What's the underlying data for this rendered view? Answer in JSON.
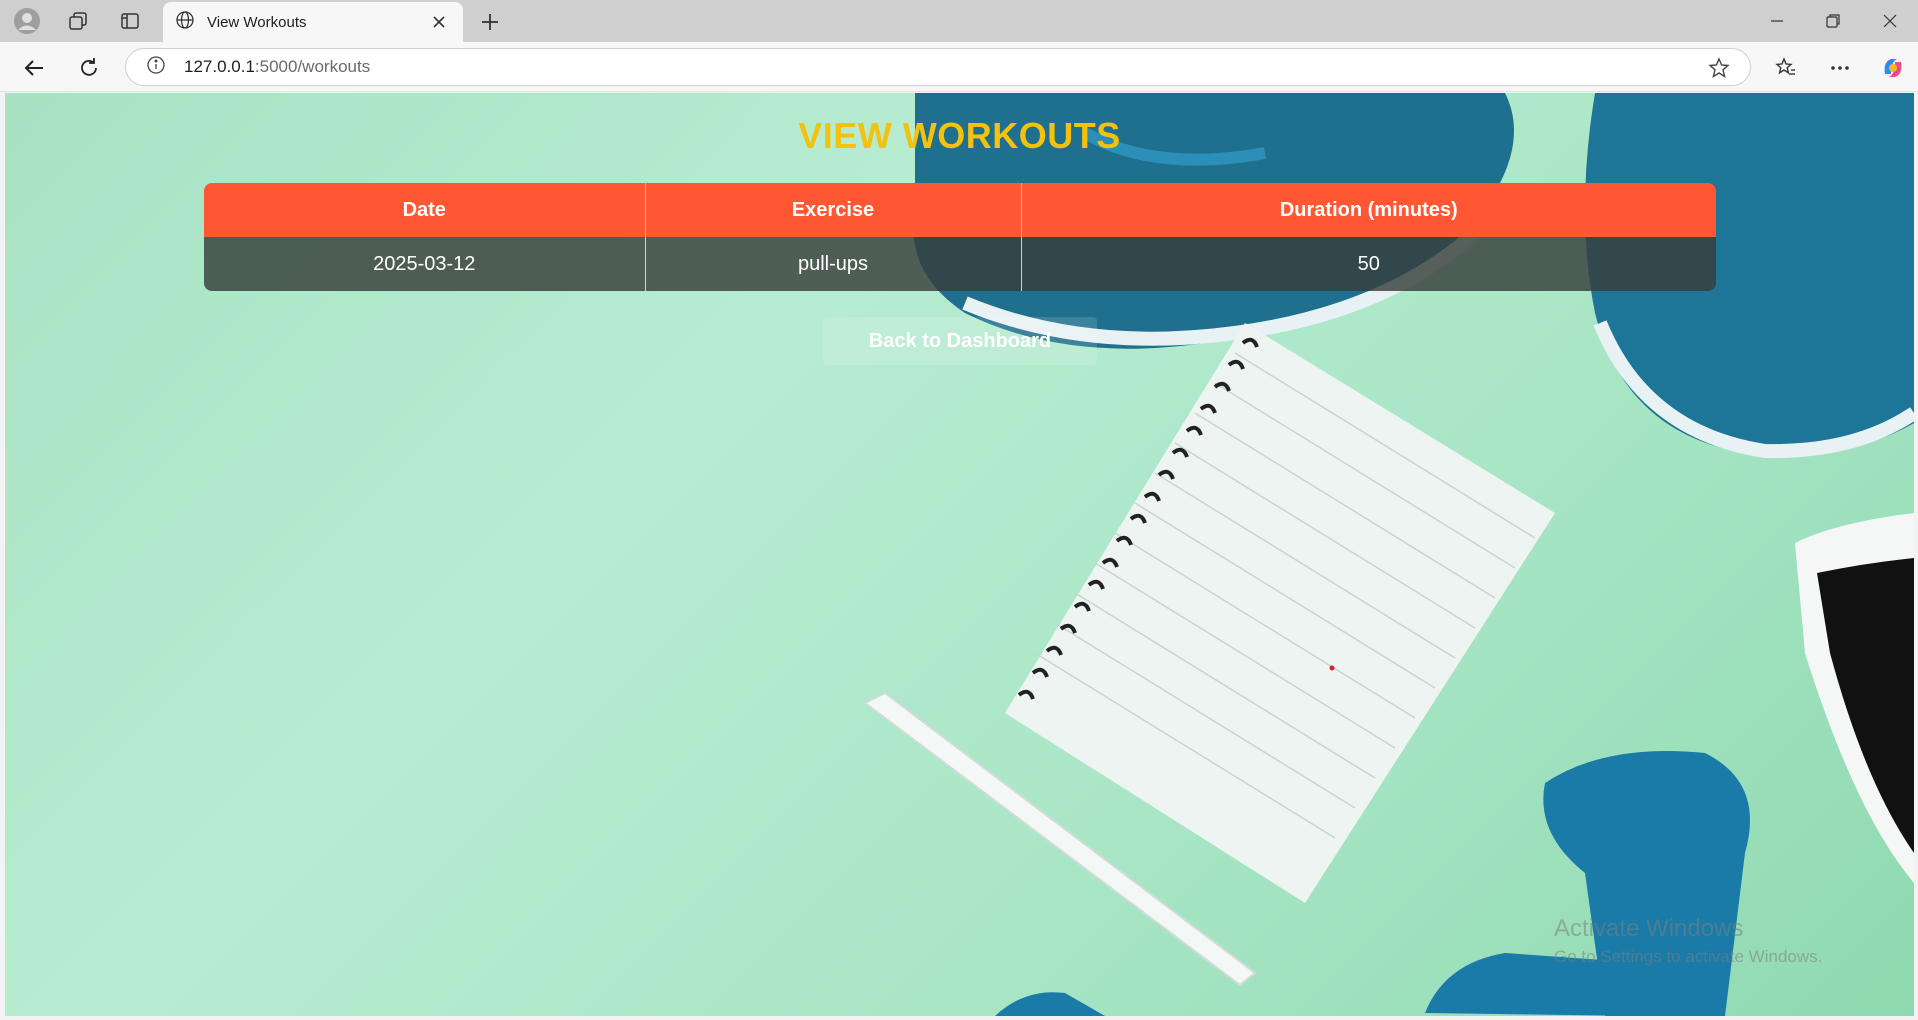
{
  "browser": {
    "tab_title": "View Workouts",
    "url_host": "127.0.0.1",
    "url_path": ":5000/workouts"
  },
  "page": {
    "title": "VIEW WORKOUTS",
    "table": {
      "headers": [
        "Date",
        "Exercise",
        "Duration (minutes)"
      ],
      "rows": [
        [
          "2025-03-12",
          "pull-ups",
          "50"
        ]
      ]
    },
    "back_button": "Back to Dashboard"
  },
  "watermark": {
    "line1": "Activate Windows",
    "line2": "Go to Settings to activate Windows."
  },
  "colors": {
    "title": "#f4c20d",
    "table_header": "#ff5733",
    "table_row": "#373e3c",
    "background": "#b7ecd0"
  },
  "icons": [
    "profile-icon",
    "workspaces-icon",
    "tab-actions-icon",
    "globe-icon",
    "close-icon",
    "plus-icon",
    "minimize-icon",
    "restore-icon",
    "window-close-icon",
    "back-arrow-icon",
    "refresh-icon",
    "info-icon",
    "star-icon",
    "favorites-icon",
    "more-icon",
    "copilot-icon"
  ]
}
